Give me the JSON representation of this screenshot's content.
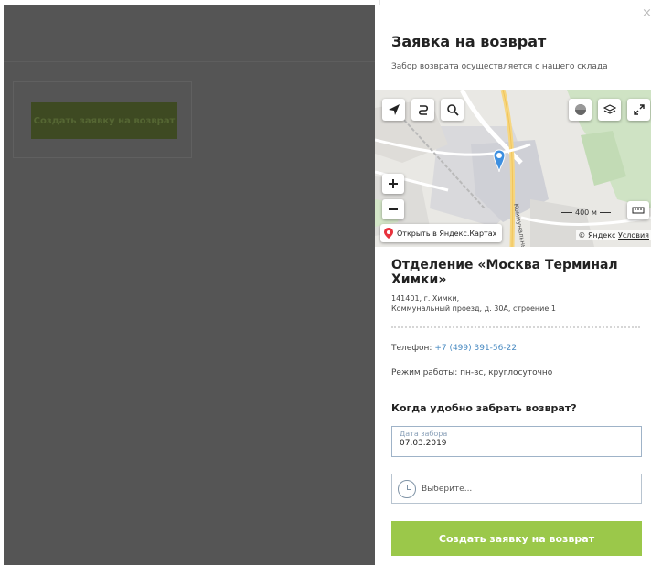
{
  "background": {
    "button_label": "Создать заявку на возврат"
  },
  "panel": {
    "title": "Заявка на возврат",
    "subtitle": "Забор возврата осуществляется с нашего склада",
    "close_label": "×"
  },
  "map": {
    "scale_label": "400 м",
    "open_in_yandex": "Открыть в Яндекс.Картах",
    "copyright_brand": "© Яндекс",
    "copyright_link": "Условия",
    "street_label": "Коммунальный"
  },
  "department": {
    "name": "Отделение «Москва Терминал Химки»",
    "address_line1": "141401, г. Химки,",
    "address_line2": "Коммунальный проезд, д. 30А, строение 1",
    "phone_label": "Телефон: ",
    "phone": "+7 (499) 391-56-22",
    "hours": "Режим работы: пн-вс, круглосуточно"
  },
  "pickup": {
    "question": "Когда удобно забрать возврат?",
    "date_label": "Дата забора",
    "date_value": "07.03.2019",
    "time_placeholder": "Выберите...",
    "submit_label": "Создать заявку на возврат"
  },
  "colors": {
    "accent_button": "#9bc84a",
    "phone_link": "#4a8bc2",
    "map_pin": "#3d8fe0"
  }
}
